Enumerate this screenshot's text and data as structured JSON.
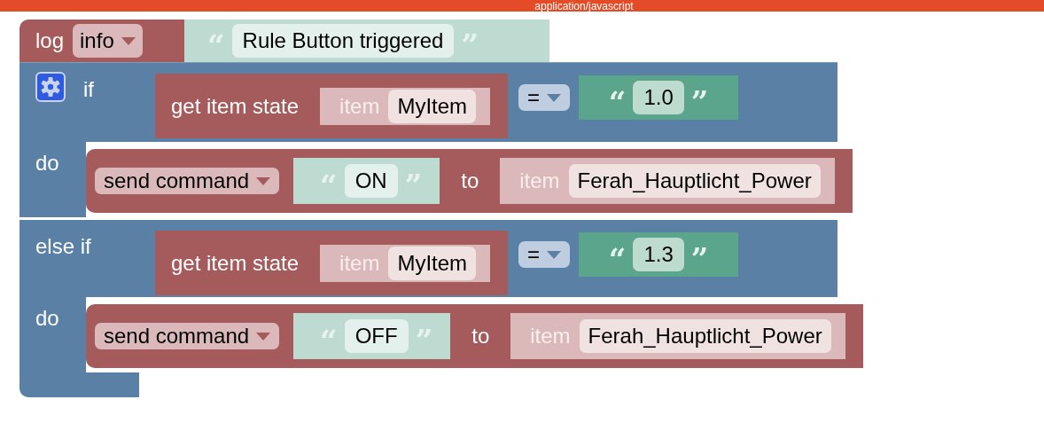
{
  "top_bar": {
    "text": "application/javascript"
  },
  "log_block": {
    "label": "log",
    "level": "info",
    "string": {
      "quotes": [
        "“",
        "”"
      ],
      "text": "Rule Button triggered"
    }
  },
  "if_block": {
    "branches": [
      {
        "label": "if",
        "has_gear": true,
        "condition": {
          "label": "get item state",
          "item_label": "item",
          "item": "MyItem",
          "operator": "=",
          "value": {
            "quotes": [
              "“",
              "”"
            ],
            "text": "1.0"
          }
        },
        "do_label": "do",
        "action": {
          "command": "send command",
          "value": {
            "quotes": [
              "“",
              "”"
            ],
            "text": "ON"
          },
          "to_label": "to",
          "item_label": "item",
          "item": "Ferah_Hauptlicht_Power"
        }
      },
      {
        "label": "else if",
        "has_gear": false,
        "condition": {
          "label": "get item state",
          "item_label": "item",
          "item": "MyItem",
          "operator": "=",
          "value": {
            "quotes": [
              "“",
              "”"
            ],
            "text": "1.3"
          }
        },
        "do_label": "do",
        "action": {
          "command": "send command",
          "value": {
            "quotes": [
              "“",
              "”"
            ],
            "text": "OFF"
          },
          "to_label": "to",
          "item_label": "item",
          "item": "Ferah_Hauptlicht_Power"
        }
      }
    ]
  }
}
